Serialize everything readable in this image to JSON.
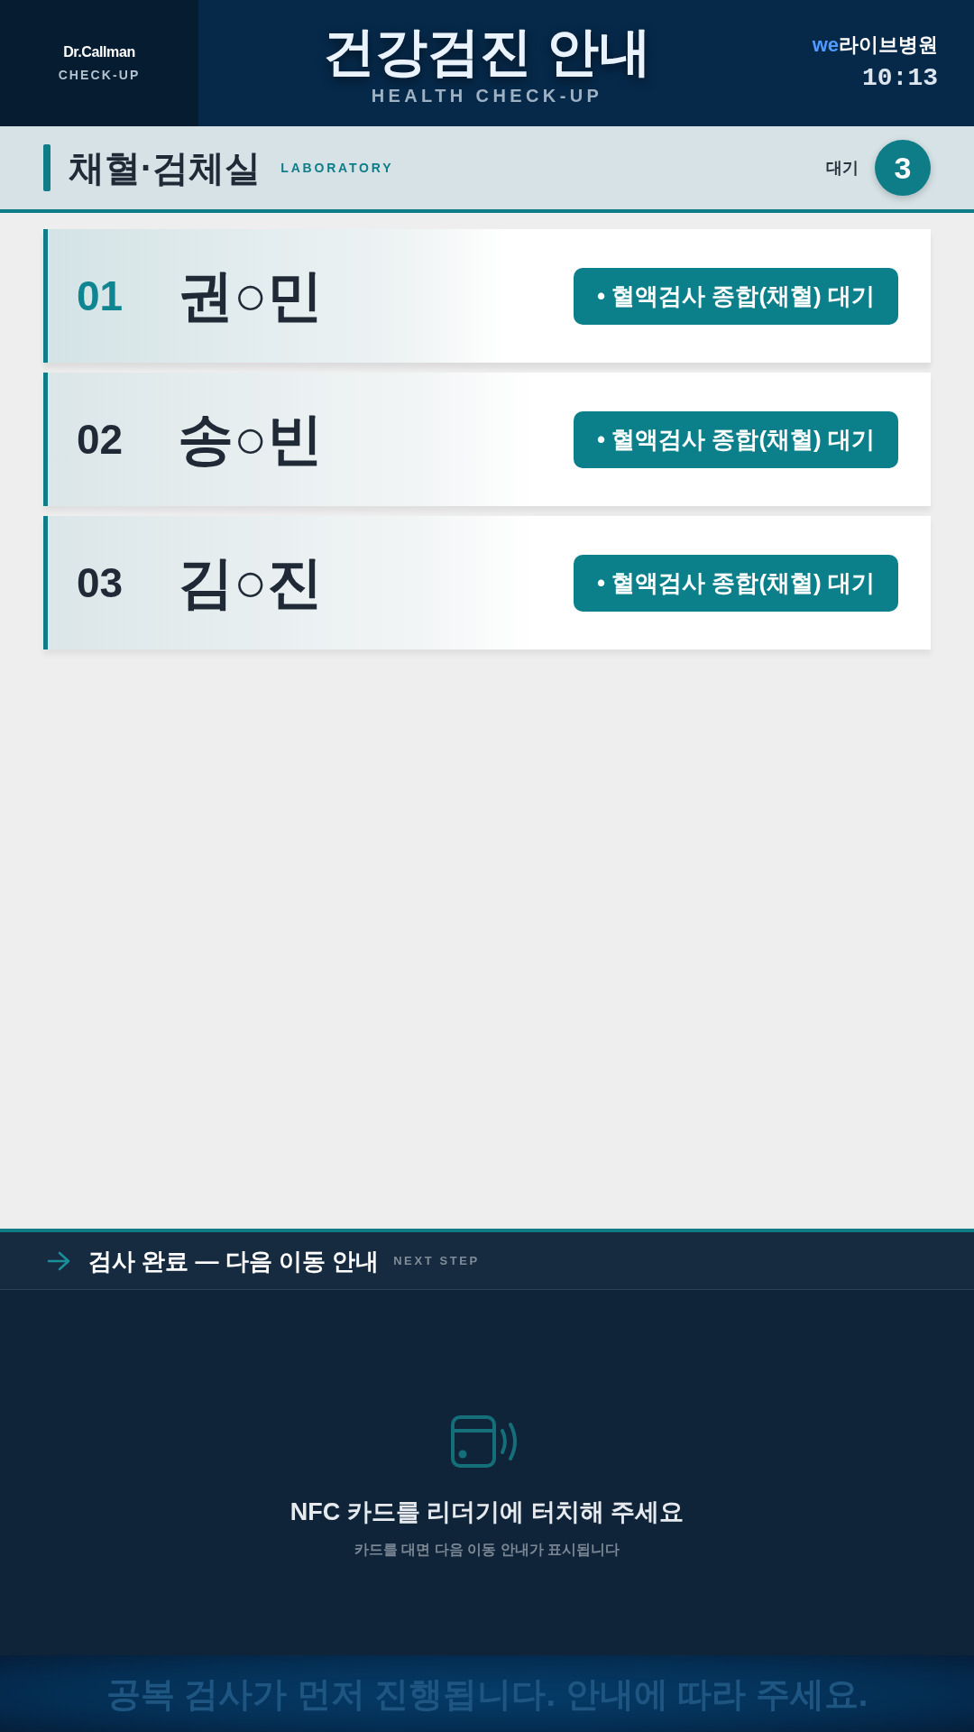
{
  "header": {
    "logo": {
      "brand": "Dr.Callman",
      "subtitle": "CHECK-UP"
    },
    "title": "건강검진 안내",
    "subtitle": "HEALTH CHECK-UP",
    "hospital": {
      "prefix": "we",
      "name": "라이브병원"
    },
    "time": "10:13"
  },
  "room": {
    "title": "채혈·검체실",
    "subtitle": "LABORATORY",
    "waiting_label": "대기",
    "waiting_count": "3"
  },
  "queue": [
    {
      "number": "01",
      "name": "권○민",
      "status": "• 혈액검사 종합(채혈) 대기",
      "selected": true
    },
    {
      "number": "02",
      "name": "송○빈",
      "status": "• 혈액검사 종합(채혈) 대기",
      "selected": false
    },
    {
      "number": "03",
      "name": "김○진",
      "status": "• 혈액검사 종합(채혈) 대기",
      "selected": false
    }
  ],
  "next_step": {
    "title": "검사 완료 — 다음 이동 안내",
    "subtitle": "NEXT STEP",
    "prompt": "NFC 카드를 리더기에 터치해 주세요",
    "hint": "카드를 대면 다음 이동 안내가 표시됩니다"
  },
  "footer": {
    "notice": "공복 검사가 먼저 진행됩니다. 안내에 따라 주세요."
  }
}
